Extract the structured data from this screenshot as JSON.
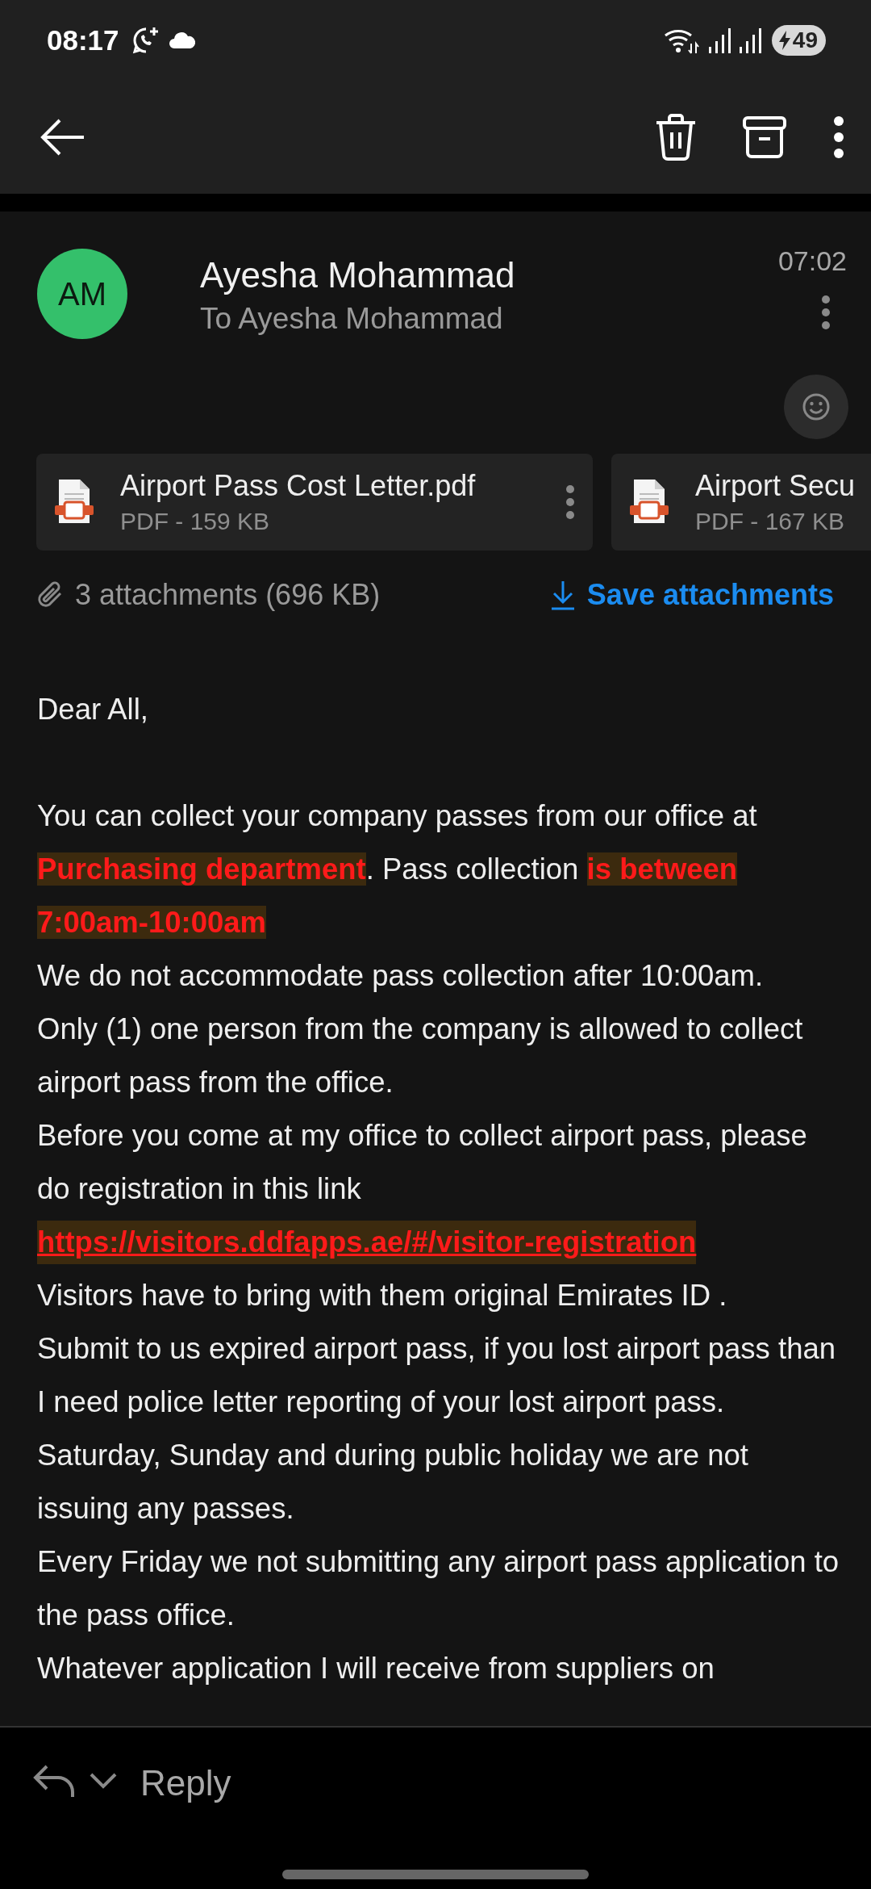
{
  "status_bar": {
    "time": "08:17",
    "battery": "49"
  },
  "message": {
    "avatar_initials": "AM",
    "sender": "Ayesha Mohammad",
    "recipients": "To Ayesha Mohammad",
    "time": "07:02"
  },
  "attachments": [
    {
      "name": "Airport Pass Cost Letter.pdf",
      "info": "PDF - 159 KB"
    },
    {
      "name": "Airport Secu",
      "info": "PDF - 167 KB"
    }
  ],
  "attachments_summary": "3 attachments (696 KB)",
  "save_attachments": "Save attachments",
  "body": [
    {
      "kind": "greeting",
      "segments": [
        {
          "text": "Dear All,",
          "highlighted": false
        }
      ]
    },
    {
      "kind": "text",
      "segments": [
        {
          "text": "You can collect your company passes from our office at ",
          "highlighted": false
        },
        {
          "text": "Purchasing department",
          "highlighted": true
        },
        {
          "text": ". Pass collection ",
          "highlighted": false
        },
        {
          "text": "is between 7:00am-10:00am",
          "highlighted": true
        }
      ]
    },
    {
      "kind": "text",
      "segments": [
        {
          "text": "We do not accommodate pass collection after 10:00am.",
          "highlighted": false
        }
      ]
    },
    {
      "kind": "text",
      "segments": [
        {
          "text": "Only (1) one person from the company is allowed to collect airport pass from the office.",
          "highlighted": false
        }
      ]
    },
    {
      "kind": "text",
      "segments": [
        {
          "text": "Before you come at my office to collect airport pass, please do registration in this link",
          "highlighted": false
        }
      ]
    },
    {
      "kind": "link",
      "segments": [
        {
          "text": "https://visitors.ddfapps.ae/#/visitor-registration",
          "highlighted": true
        }
      ]
    },
    {
      "kind": "text",
      "segments": [
        {
          "text": "Visitors have to bring with them original Emirates ID .",
          "highlighted": false
        }
      ]
    },
    {
      "kind": "text",
      "segments": [
        {
          "text": "Submit to us expired airport pass, if you lost airport pass than I need police letter reporting of your lost airport pass.",
          "highlighted": false
        }
      ]
    },
    {
      "kind": "text",
      "segments": [
        {
          "text": "Saturday, Sunday and during public holiday we are not issuing any passes.",
          "highlighted": false
        }
      ]
    },
    {
      "kind": "text",
      "segments": [
        {
          "text": "Every Friday we not submitting any airport pass application to the pass office.",
          "highlighted": false
        }
      ]
    },
    {
      "kind": "text",
      "segments": [
        {
          "text": "Whatever application I will receive from suppliers on",
          "highlighted": false
        }
      ]
    }
  ],
  "reply_bar": {
    "label": "Reply"
  }
}
